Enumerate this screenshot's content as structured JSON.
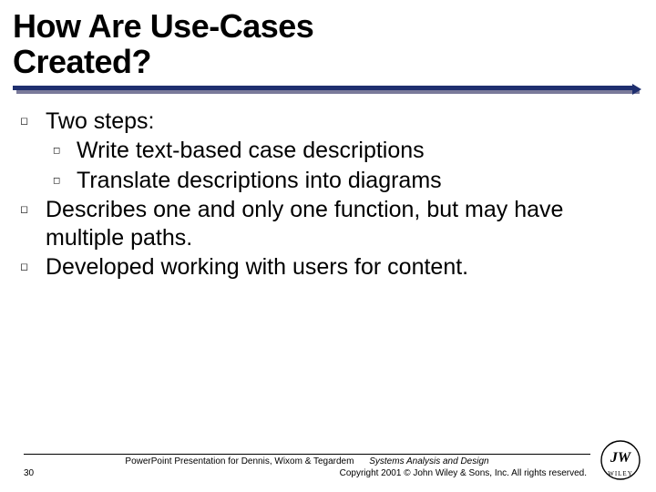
{
  "title_line1": "How Are Use-Cases",
  "title_line2": "Created?",
  "bullets": {
    "b1": "Two steps:",
    "b1a": "Write text-based case descriptions",
    "b1b": "Translate descriptions into diagrams",
    "b2": "Describes one and only one function, but may have multiple paths.",
    "b3": "Developed working with users for content."
  },
  "footer": {
    "credit": "PowerPoint Presentation for Dennis, Wixom & Tegardem",
    "book": "Systems Analysis and Design",
    "page": "30",
    "copyright": "Copyright 2001 © John Wiley & Sons, Inc.  All rights reserved."
  },
  "publisher": "Wiley"
}
